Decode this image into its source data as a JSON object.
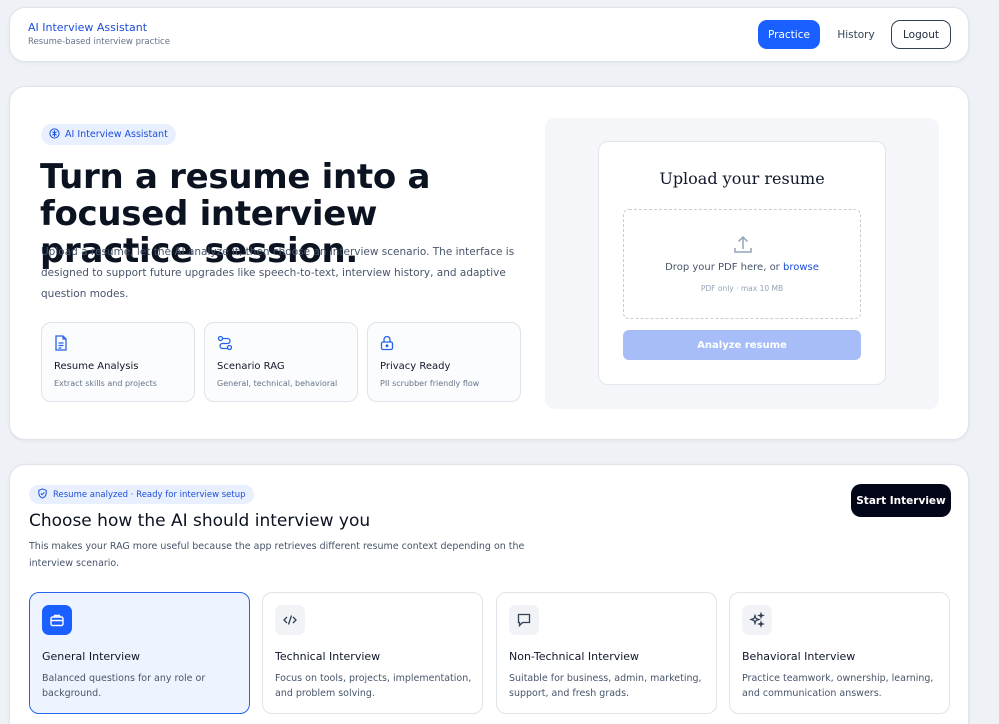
{
  "nav": {
    "brand_title": "AI Interview Assistant",
    "brand_subtitle": "Resume-based interview practice",
    "practice_label": "Practice",
    "history_label": "History",
    "logout_label": "Logout"
  },
  "hero": {
    "pill_label": "AI Interview Assistant",
    "title": "Turn a resume into a focused interview practice session.",
    "description": "Upload a resume, let the AI analyze it, then choose an interview scenario. The interface is designed to support future upgrades like speech-to-text, interview history, and adaptive question modes.",
    "features": [
      {
        "icon": "document-icon",
        "title": "Resume Analysis",
        "subtitle": "Extract skills and projects"
      },
      {
        "icon": "route-icon",
        "title": "Scenario RAG",
        "subtitle": "General, technical, behavioral"
      },
      {
        "icon": "lock-icon",
        "title": "Privacy Ready",
        "subtitle": "PII scrubber friendly flow"
      }
    ]
  },
  "upload": {
    "title": "Upload your resume",
    "drop_text": "Drop your PDF here, or ",
    "browse_label": "browse",
    "hint": "PDF only · max 10 MB",
    "analyze_label": "Analyze resume"
  },
  "scenario": {
    "status_label": "Resume analyzed · Ready for interview setup",
    "title": "Choose how the AI should interview you",
    "description": "This makes your RAG more useful because the app retrieves different resume context depending on the interview scenario.",
    "start_label": "Start Interview",
    "options": [
      {
        "icon": "briefcase-icon",
        "title": "General Interview",
        "description": "Balanced questions for any role or background.",
        "selected": true
      },
      {
        "icon": "code-icon",
        "title": "Technical Interview",
        "description": "Focus on tools, projects, implementation, and problem solving.",
        "selected": false
      },
      {
        "icon": "chat-icon",
        "title": "Non-Technical Interview",
        "description": "Suitable for business, admin, marketing, support, and fresh grads.",
        "selected": false
      },
      {
        "icon": "sparkles-icon",
        "title": "Behavioral Interview",
        "description": "Practice teamwork, ownership, learning, and communication answers.",
        "selected": false
      }
    ]
  },
  "colors": {
    "accent": "#1a5fff",
    "accent_light": "#e8f0ff",
    "disabled_button": "#a7bdf7",
    "start_button": "#020617"
  }
}
